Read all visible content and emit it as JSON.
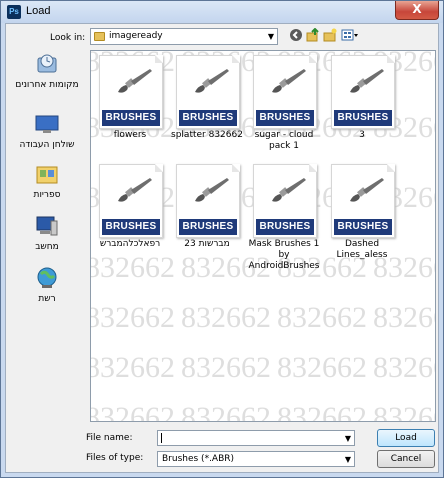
{
  "window": {
    "title": "Load",
    "app_icon": "Ps",
    "close_glyph": "X"
  },
  "toolbar": {
    "look_in_label": "Look in:",
    "look_in_value": "imageready",
    "icons": [
      "back-icon",
      "up-folder-icon",
      "new-folder-icon",
      "view-menu-icon"
    ]
  },
  "places": [
    {
      "label": "מקומות אחרונים",
      "icon": "recent-places-icon"
    },
    {
      "label": "שולחן העבודה",
      "icon": "desktop-icon"
    },
    {
      "label": "ספריות",
      "icon": "libraries-icon"
    },
    {
      "label": "מחשב",
      "icon": "computer-icon"
    },
    {
      "label": "רשת",
      "icon": "network-icon"
    }
  ],
  "files": [
    {
      "name": "flowers",
      "thumb_label": "BRUSHES"
    },
    {
      "name": "splatter 832662",
      "thumb_label": "BRUSHES"
    },
    {
      "name": "sugar - cloud pack 1",
      "thumb_label": "BRUSHES"
    },
    {
      "name": "3",
      "thumb_label": "BRUSHES"
    },
    {
      "name": "רפאלכלהמברש",
      "thumb_label": "BRUSHES"
    },
    {
      "name": "23 מברשות",
      "thumb_label": "BRUSHES"
    },
    {
      "name": "Mask Brushes 1 by AndroidBrushes",
      "thumb_label": "BRUSHES"
    },
    {
      "name": "Dashed Lines_aless",
      "thumb_label": "BRUSHES"
    }
  ],
  "watermark_text": "832662",
  "form": {
    "file_name_label": "File name:",
    "file_name_value": "",
    "files_of_type_label": "Files of type:",
    "files_of_type_value": "Brushes (*.ABR)"
  },
  "buttons": {
    "load": "Load",
    "cancel": "Cancel"
  },
  "colors": {
    "accent": "#1f3a7a",
    "window_frame": "#c9d9ef",
    "close": "#c7463a"
  }
}
